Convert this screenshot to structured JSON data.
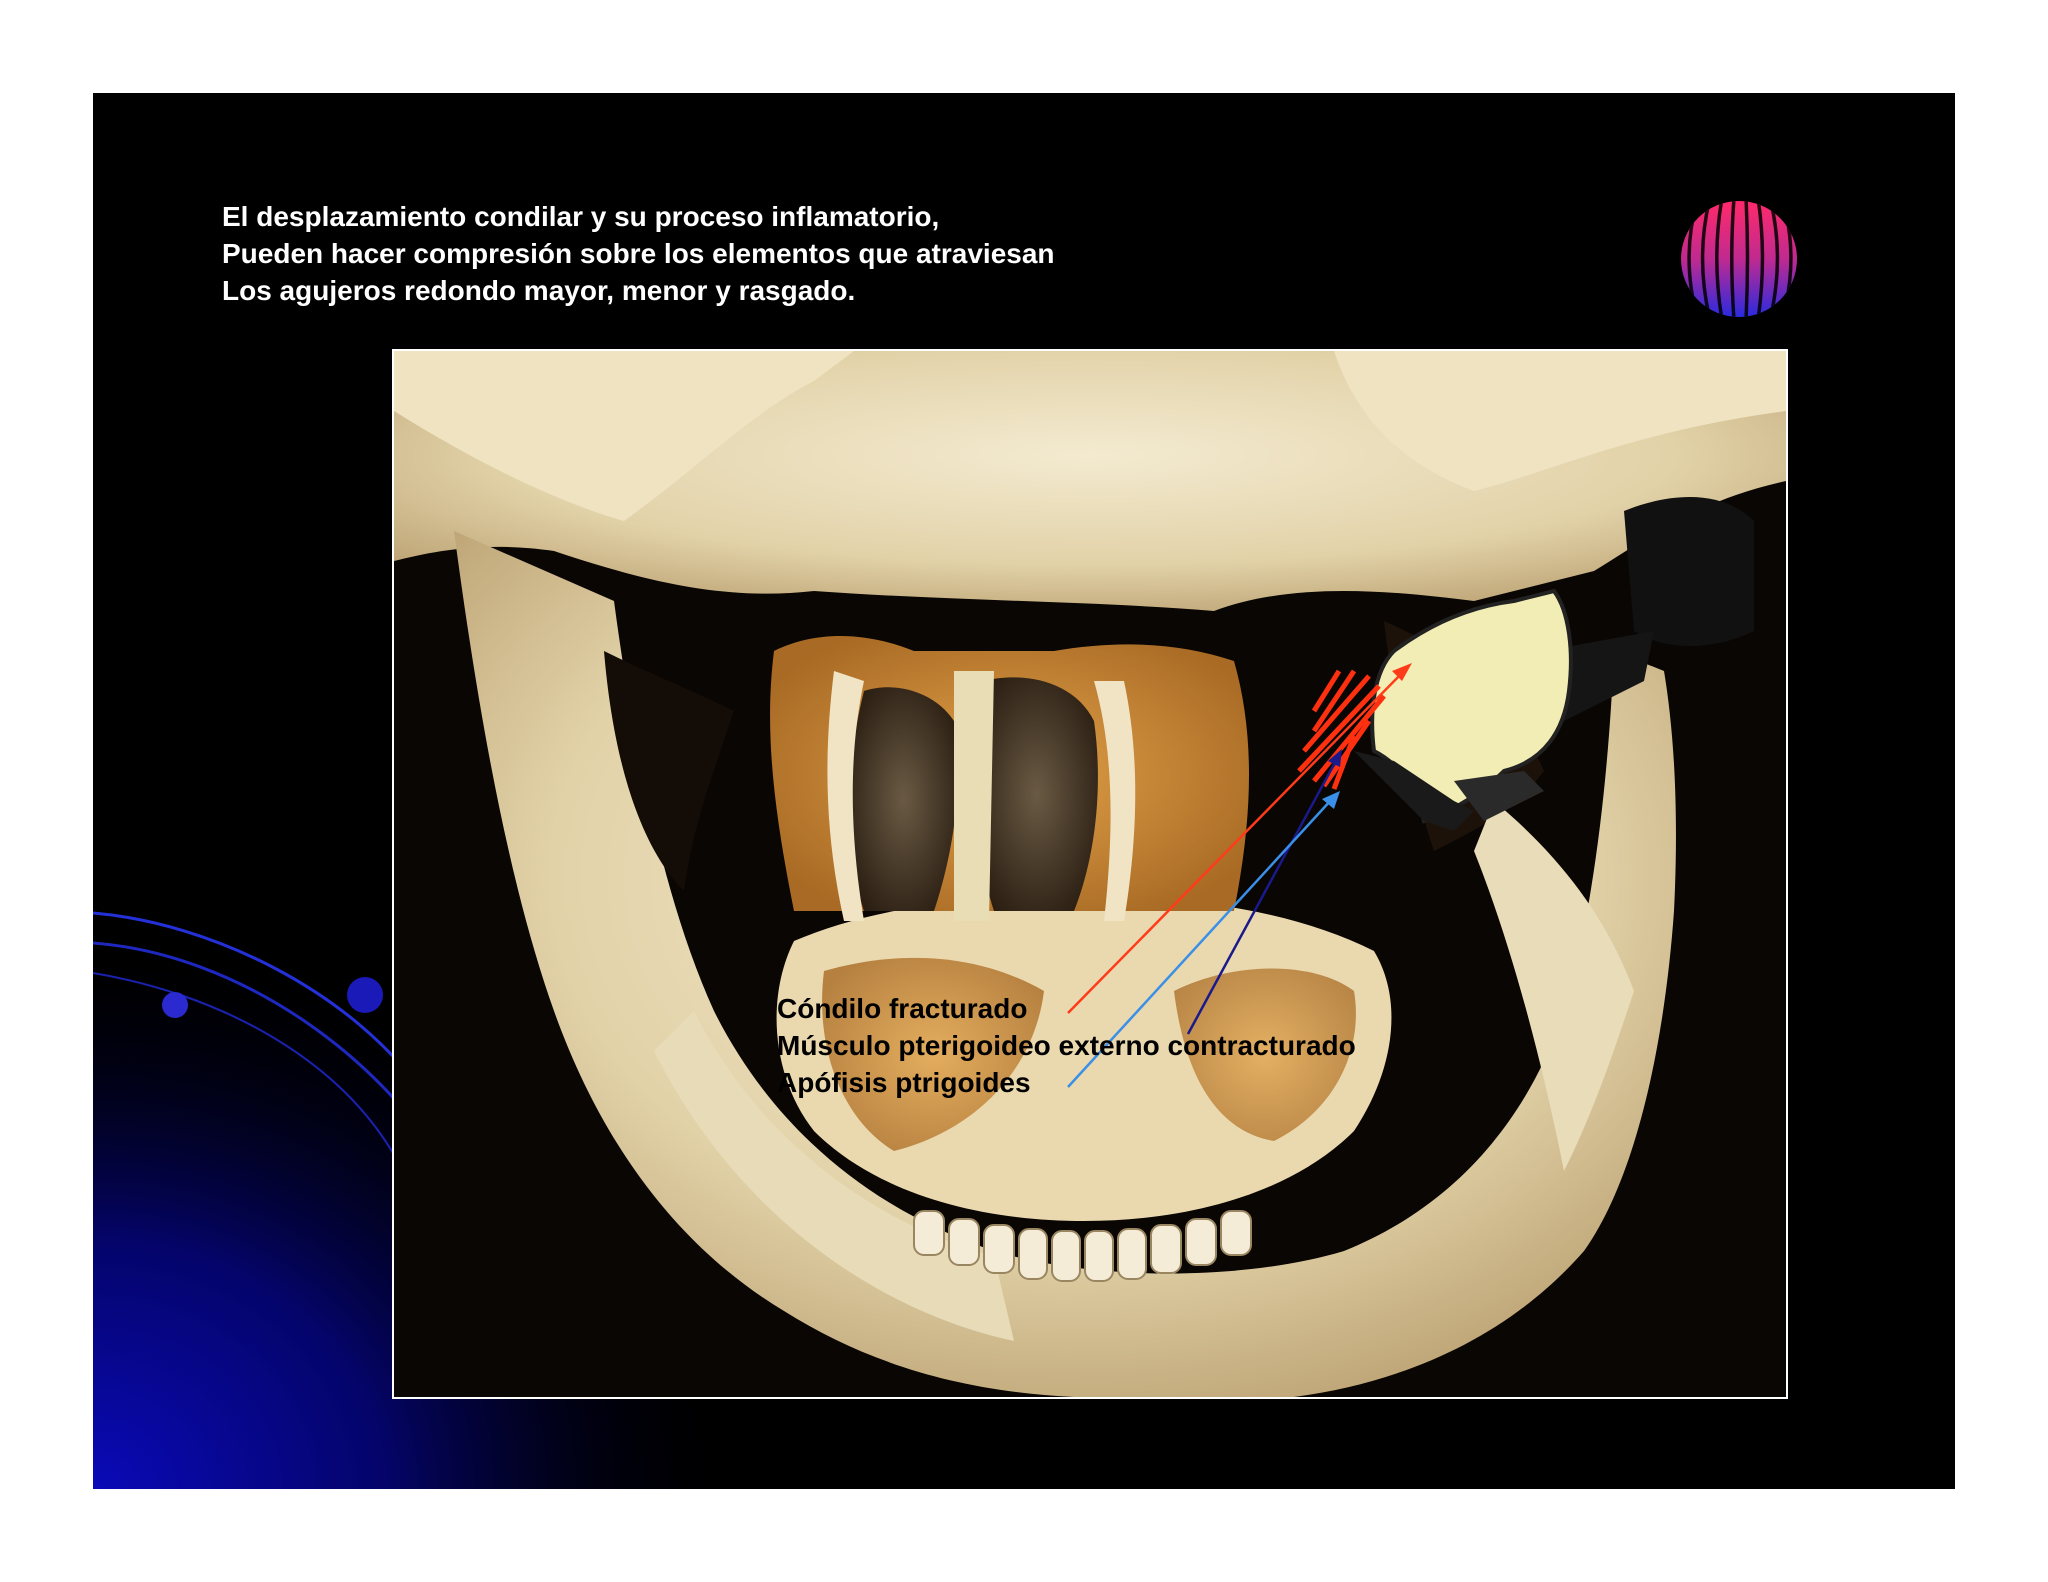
{
  "slide": {
    "text_lines": [
      "El desplazamiento condilar  y su proceso inflamatorio,",
      "Pueden hacer compresión sobre los elementos que atraviesan",
      "Los agujeros redondo mayor, menor y rasgado."
    ],
    "labels": {
      "condyle": "Cóndilo fracturado",
      "muscle": "Músculo pterigoideo externo contracturado",
      "apophysis": "Apófisis ptrigoides"
    }
  },
  "colors": {
    "slide_background": "#000000",
    "text": "#ffffff",
    "arrow_condyle": "#ff3b1a",
    "arrow_muscle": "#1a1a8c",
    "arrow_apophysis": "#3a8fe8",
    "muscle_fibers": "#ff3010",
    "condyle_fill": "#f1edb4"
  },
  "icons": {
    "corner_decoration": "striped-sphere-icon"
  }
}
